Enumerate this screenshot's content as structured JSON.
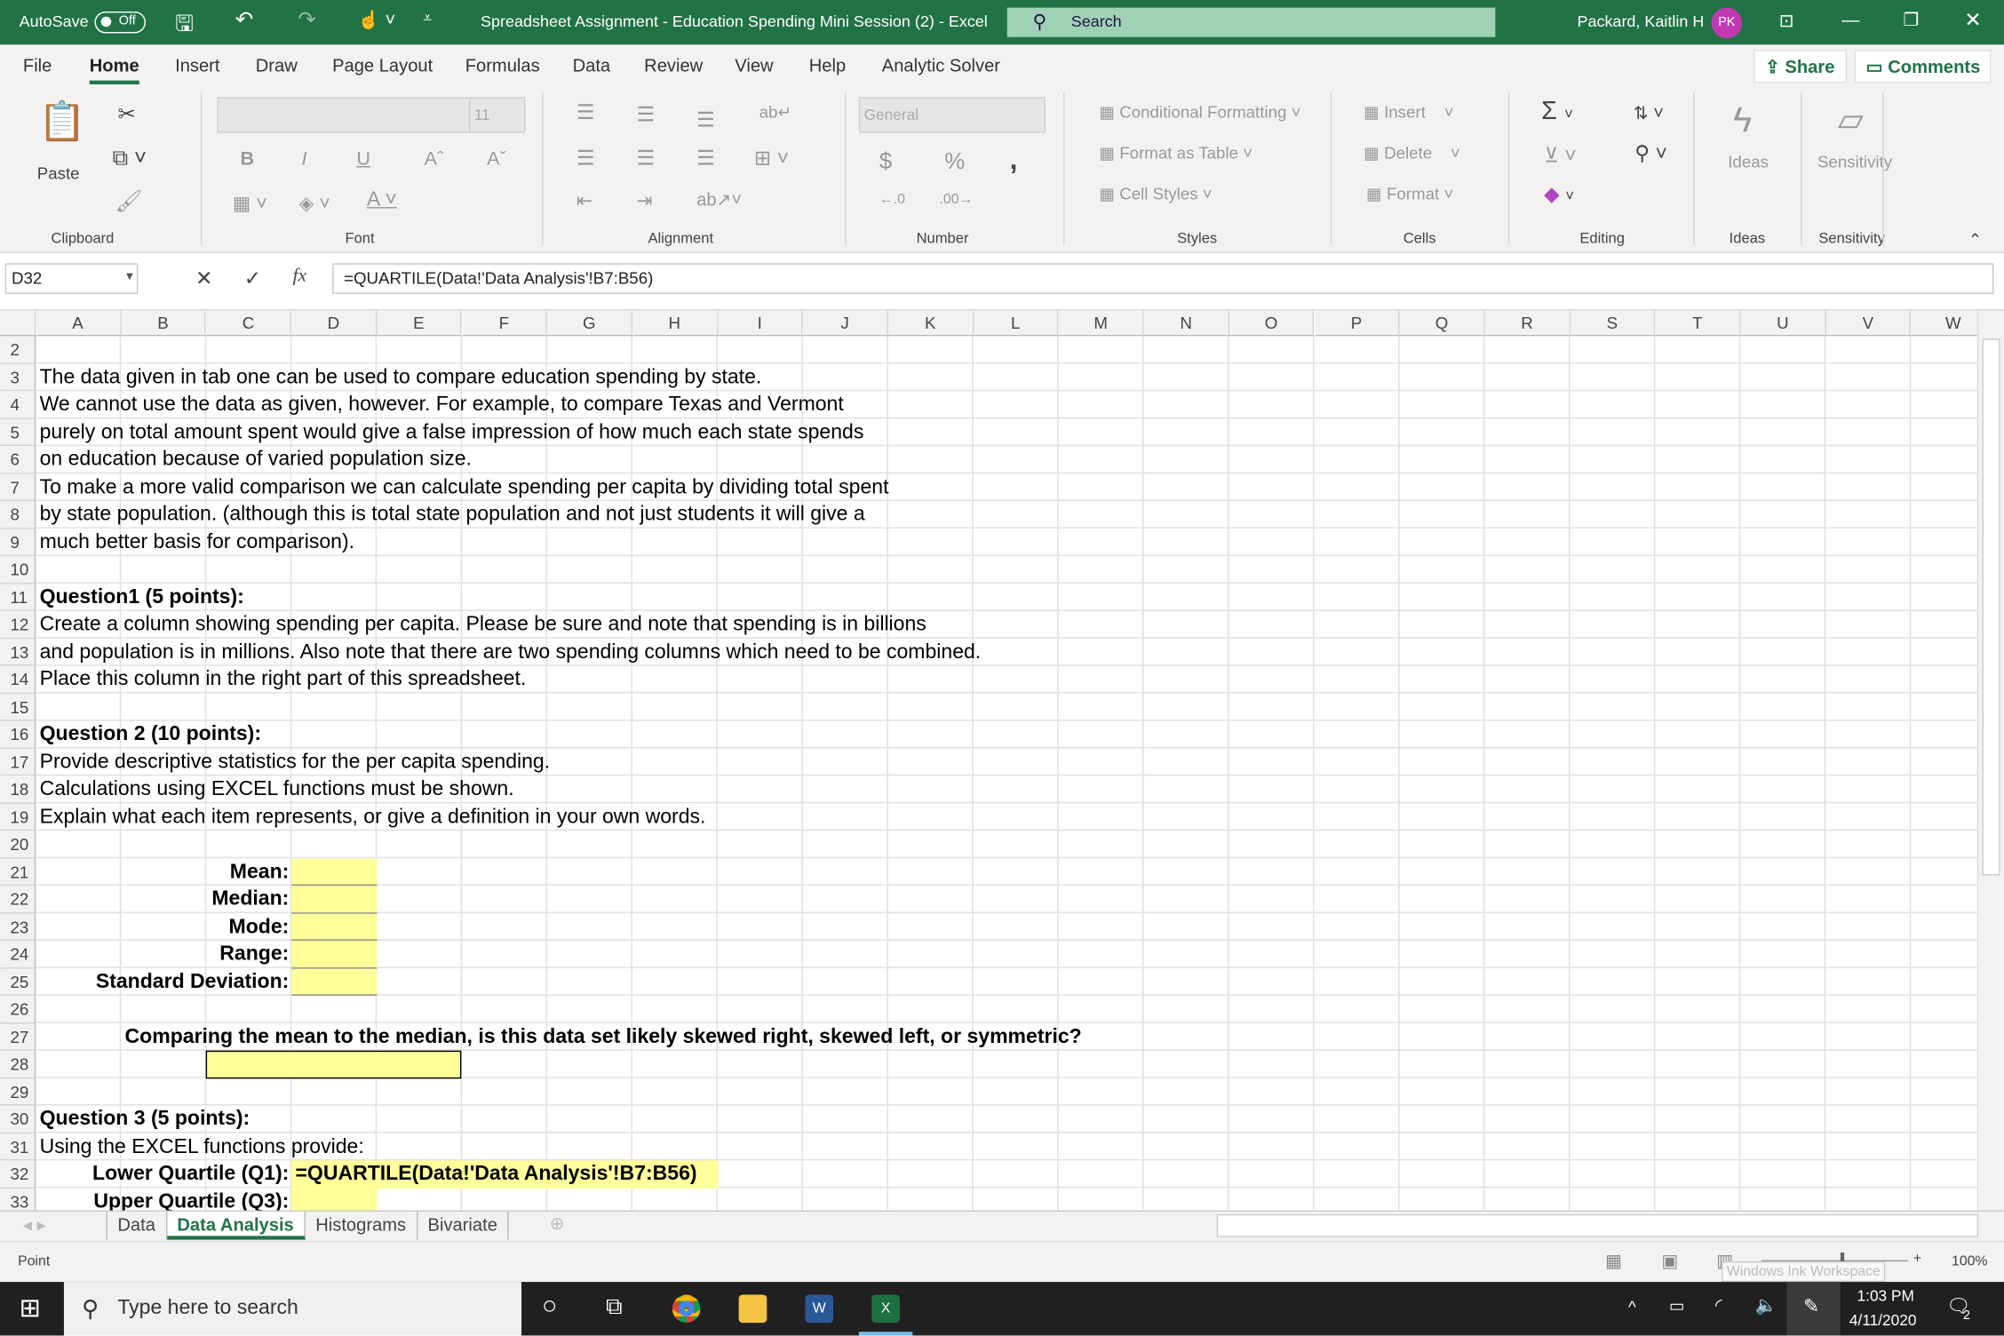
{
  "titlebar": {
    "autosave_label": "AutoSave",
    "autosave_state": "Off",
    "title": "Spreadsheet Assignment - Education Spending Mini Session (2)  -  Excel",
    "search_placeholder": "Search",
    "user_name": "Packard, Kaitlin H",
    "user_initials": "PK",
    "accent": "#217346",
    "avatar_color": "#c239b3"
  },
  "menu": {
    "tabs": [
      "File",
      "Home",
      "Insert",
      "Draw",
      "Page Layout",
      "Formulas",
      "Data",
      "Review",
      "View",
      "Help",
      "Analytic Solver"
    ],
    "active": "Home",
    "share": "Share",
    "comments": "Comments"
  },
  "ribbon": {
    "clipboard": {
      "label": "Clipboard",
      "paste": "Paste"
    },
    "font": {
      "label": "Font",
      "font_size": "11",
      "bold": "B",
      "italic": "I",
      "underline": "U"
    },
    "alignment": {
      "label": "Alignment"
    },
    "number": {
      "label": "Number",
      "format": "General",
      "currency": "$",
      "percent": "%",
      "comma": ","
    },
    "styles": {
      "label": "Styles",
      "items": [
        "Conditional Formatting",
        "Format as Table",
        "Cell Styles"
      ]
    },
    "cells": {
      "label": "Cells",
      "items": [
        "Insert",
        "Delete",
        "Format"
      ]
    },
    "editing": {
      "label": "Editing",
      "sum": "Σ"
    },
    "ideas": {
      "label": "Ideas",
      "button": "Ideas"
    },
    "sensitivity": {
      "label": "Sensitivity",
      "button": "Sensitivity"
    }
  },
  "formula_bar": {
    "name_box": "D32",
    "formula": "=QUARTILE(Data!'Data Analysis'!B7:B56)",
    "fx": "fx"
  },
  "grid": {
    "columns": [
      "A",
      "B",
      "C",
      "D",
      "E",
      "F",
      "G",
      "H",
      "I",
      "J",
      "K",
      "L",
      "M",
      "N",
      "O",
      "P",
      "Q",
      "R",
      "S",
      "T",
      "U",
      "V",
      "W"
    ],
    "rows": [
      2,
      3,
      4,
      5,
      6,
      7,
      8,
      9,
      10,
      11,
      12,
      13,
      14,
      15,
      16,
      17,
      18,
      19,
      20,
      21,
      22,
      23,
      24,
      25,
      26,
      27,
      28,
      29,
      30,
      31,
      32,
      33
    ],
    "highlight_color": "#ffff99",
    "highlights": [
      "D21",
      "D22",
      "D23",
      "D24",
      "D25",
      "C28:E28",
      "D32:H32",
      "D33"
    ],
    "cells": [
      {
        "ref": "A3",
        "text": "The data given in tab one can be used to compare education spending by state."
      },
      {
        "ref": "A4",
        "text": "We cannot use the data as given, however.   For example, to compare Texas and Vermont"
      },
      {
        "ref": "A5",
        "text": "purely on total amount spent would give a false impression of how much each state spends"
      },
      {
        "ref": "A6",
        "text": "on education because of varied population size."
      },
      {
        "ref": "A7",
        "text": "To make a more valid comparison we can calculate spending per capita by dividing total spent"
      },
      {
        "ref": "A8",
        "text": "by state population.  (although this is total state population and not just students it will give a"
      },
      {
        "ref": "A9",
        "text": "much better basis for comparison)."
      },
      {
        "ref": "A11",
        "text": "Question1 (5 points):",
        "bold": true
      },
      {
        "ref": "A12",
        "text": "Create a column showing spending per capita.  Please be sure and note that spending is in billions"
      },
      {
        "ref": "A13",
        "text": "and population is in millions.   Also note that there are two spending columns which need to be combined."
      },
      {
        "ref": "A14",
        "text": "Place this column in the right part of this spreadsheet."
      },
      {
        "ref": "A16",
        "text": "Question 2 (10 points):",
        "bold": true
      },
      {
        "ref": "A17",
        "text": "Provide descriptive statistics for the per capita spending."
      },
      {
        "ref": "A18",
        "text": "Calculations using EXCEL functions must be shown."
      },
      {
        "ref": "A19",
        "text": "Explain what each item represents, or give a definition in your own words."
      },
      {
        "ref": "C21",
        "text": "Mean:",
        "bold": true,
        "align": "right"
      },
      {
        "ref": "C22",
        "text": "Median:",
        "bold": true,
        "align": "right"
      },
      {
        "ref": "C23",
        "text": "Mode:",
        "bold": true,
        "align": "right"
      },
      {
        "ref": "C24",
        "text": "Range:",
        "bold": true,
        "align": "right"
      },
      {
        "ref": "C25",
        "text": "Standard Deviation:",
        "bold": true,
        "align": "right"
      },
      {
        "ref": "B27",
        "text": "Comparing the mean to the median, is this data set likely skewed right, skewed left, or symmetric?",
        "bold": true
      },
      {
        "ref": "A30",
        "text": "Question 3 (5 points):",
        "bold": true
      },
      {
        "ref": "A31",
        "text": "Using the EXCEL functions provide:"
      },
      {
        "ref": "C32",
        "text": "Lower Quartile (Q1):",
        "bold": true,
        "align": "right"
      },
      {
        "ref": "D32",
        "text": "=QUARTILE(Data!'Data Analysis'!B7:B56)",
        "bold": true,
        "formula_edit": true
      },
      {
        "ref": "C33",
        "text": "Upper Quartile (Q3):",
        "bold": true,
        "align": "right"
      }
    ]
  },
  "sheets": {
    "tabs": [
      "Data",
      "Data Analysis",
      "Histograms",
      "Bivariate"
    ],
    "active": "Data Analysis"
  },
  "status": {
    "mode": "Point",
    "zoom": "100%",
    "tooltip": "Windows Ink Workspace"
  },
  "taskbar": {
    "search_placeholder": "Type here to search",
    "time": "1:03 PM",
    "date": "4/11/2020",
    "notifications": "2"
  }
}
